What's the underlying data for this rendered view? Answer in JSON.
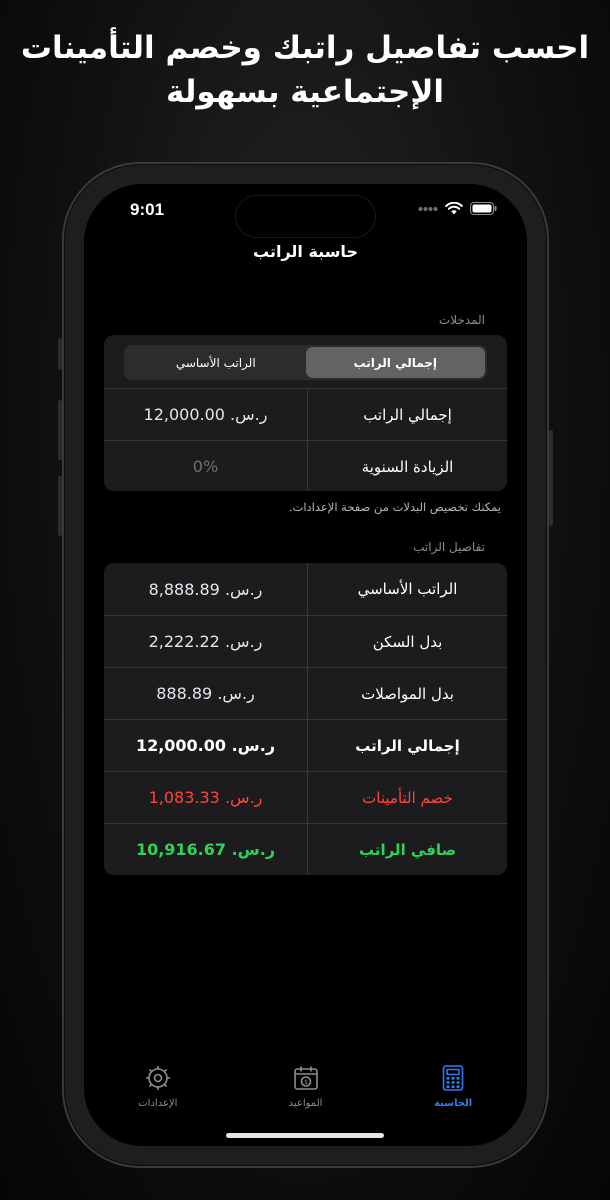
{
  "headline": {
    "line1": "احسب تفاصيل راتبك وخصم التأمينات",
    "line2": "الإجتماعية بسهولة"
  },
  "status_bar": {
    "time": "9:01"
  },
  "nav": {
    "title": "حاسبة الراتب"
  },
  "inputs": {
    "section_label": "المدخلات",
    "segments": [
      {
        "label": "إجمالي الراتب",
        "selected": true
      },
      {
        "label": "الراتب الأساسي",
        "selected": false
      }
    ],
    "rows": [
      {
        "label": "إجمالي الراتب",
        "value": "ر.س. 12,000.00"
      },
      {
        "label": "الزيادة السنوية",
        "value": "",
        "placeholder": "0%"
      }
    ]
  },
  "footnote": "يمكنك تخصيص البدلات من صفحة الإعدادات.",
  "details": {
    "section_label": "تفاصيل الراتب",
    "rows": [
      {
        "label": "الراتب الأساسي",
        "value": "ر.س. 8,888.89"
      },
      {
        "label": "بدل السكن",
        "value": "ر.س. 2,222.22"
      },
      {
        "label": "بدل المواصلات",
        "value": "ر.س. 888.89"
      },
      {
        "label": "إجمالي الراتب",
        "value": "ر.س. 12,000.00"
      },
      {
        "label": "خصم التأمينات",
        "value": "ر.س. 1,083.33"
      },
      {
        "label": "صافي الراتب",
        "value": "ر.س. 10,916.67"
      }
    ]
  },
  "tabbar": {
    "tabs": [
      {
        "label": "الإعدادات",
        "icon": "gear-icon",
        "active": false
      },
      {
        "label": "المواعيد",
        "icon": "calendar-icon",
        "active": false
      },
      {
        "label": "الحاسبة",
        "icon": "calculator-icon",
        "active": true
      }
    ]
  },
  "colors": {
    "accent": "#2f7cf6",
    "negative": "#ff453a",
    "positive": "#30d158"
  }
}
